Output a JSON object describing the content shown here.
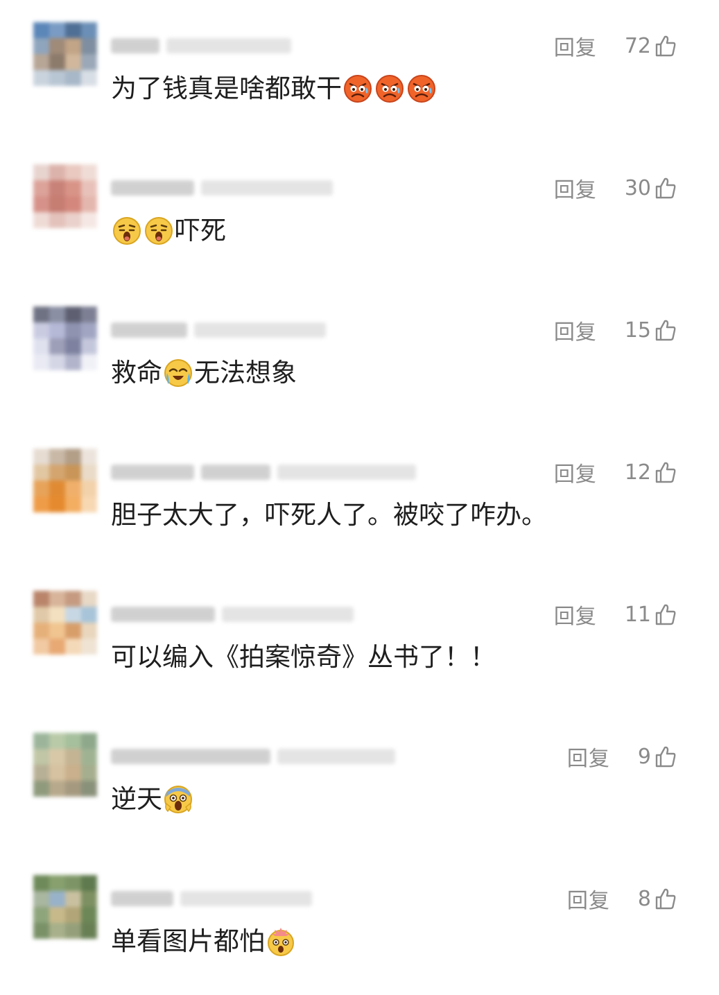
{
  "comments": [
    {
      "reply_label": "回复",
      "like_count": "72",
      "parts": [
        {
          "t": "text",
          "v": "为了钱真是啥都敢干"
        },
        {
          "t": "emoji",
          "icon": "angry-sweat-emoji"
        },
        {
          "t": "emoji",
          "icon": "angry-sweat-emoji"
        },
        {
          "t": "emoji",
          "icon": "angry-sweat-emoji"
        }
      ],
      "avatar_colors": [
        "#5b86b8",
        "#7a9cc4",
        "#4f6f95",
        "#6b8fb6",
        "#8fa5bd",
        "#a08a78",
        "#c2a486",
        "#7f8ea0",
        "#b7a596",
        "#8c7a6a",
        "#d1b79b",
        "#9aa8b8",
        "#c9d3dd",
        "#b8c6d4",
        "#a8b8c8",
        "#d8dee5"
      ],
      "name_blocks": [
        70,
        0,
        180
      ]
    },
    {
      "reply_label": "回复",
      "like_count": "30",
      "parts": [
        {
          "t": "emoji",
          "icon": "shocked-yawn-emoji"
        },
        {
          "t": "emoji",
          "icon": "shocked-yawn-emoji"
        },
        {
          "t": "text",
          "v": "吓死"
        }
      ],
      "avatar_colors": [
        "#e8d4cf",
        "#dcb3ab",
        "#e9c9c0",
        "#f0dcd6",
        "#dca39a",
        "#c98278",
        "#d99488",
        "#e8c2ba",
        "#d6928a",
        "#c67d72",
        "#d4887d",
        "#e4b7ae",
        "#efdbd6",
        "#e3c2bb",
        "#ead1cb",
        "#f5e8e4"
      ],
      "name_blocks": [
        120,
        0,
        190
      ]
    },
    {
      "reply_label": "回复",
      "like_count": "15",
      "parts": [
        {
          "t": "text",
          "v": "救命"
        },
        {
          "t": "emoji",
          "icon": "crying-emoji"
        },
        {
          "t": "text",
          "v": "无法想象"
        }
      ],
      "avatar_colors": [
        "#6f7283",
        "#8b8fa3",
        "#5e6072",
        "#7d8094",
        "#c9cbe1",
        "#b5b9d6",
        "#8f93b0",
        "#a1a5c2",
        "#dfe1ef",
        "#9d9fb8",
        "#7e82a0",
        "#c4c7dc",
        "#e9eaf3",
        "#d4d6e6",
        "#b1b4cb",
        "#f0f1f7"
      ],
      "name_blocks": [
        110,
        0,
        190
      ]
    },
    {
      "reply_label": "回复",
      "like_count": "12",
      "parts": [
        {
          "t": "text",
          "v": "胆子太大了，吓死人了。被咬了咋办。"
        }
      ],
      "avatar_colors": [
        "#e6dcd2",
        "#c9b8a6",
        "#b39e88",
        "#ece4dc",
        "#e2c7a3",
        "#d4a56f",
        "#c99558",
        "#eadbc8",
        "#e7a35a",
        "#e08b34",
        "#f0b06b",
        "#f2d2aa",
        "#ef9c48",
        "#e58a2f",
        "#f3ae62",
        "#f7d8b3"
      ],
      "name_blocks": [
        120,
        100,
        200
      ]
    },
    {
      "reply_label": "回复",
      "like_count": "11",
      "parts": [
        {
          "t": "text",
          "v": "可以编入《拍案惊奇》丛书了！！"
        }
      ],
      "avatar_colors": [
        "#b9846a",
        "#d7b49a",
        "#c59a80",
        "#e8d8c6",
        "#e0c9a8",
        "#f2e0c0",
        "#c7d8e4",
        "#a8c4d8",
        "#e6b07a",
        "#f0c590",
        "#d89e6a",
        "#e9d6bd",
        "#f1c9a2",
        "#e8a974",
        "#f4d9b9",
        "#efe3d3"
      ],
      "name_blocks": [
        150,
        0,
        190
      ]
    },
    {
      "reply_label": "回复",
      "like_count": "9",
      "parts": [
        {
          "t": "text",
          "v": "逆天"
        },
        {
          "t": "emoji",
          "icon": "screaming-emoji"
        }
      ],
      "avatar_colors": [
        "#9cb59a",
        "#b8caa8",
        "#a6bf9c",
        "#8ea88b",
        "#c0c6a6",
        "#d8c8a8",
        "#c4b494",
        "#9fb393",
        "#b8b096",
        "#d6c2a0",
        "#cab08c",
        "#a5ae8e",
        "#8f9a7c",
        "#b7a98b",
        "#a59a80",
        "#8a917a"
      ],
      "name_blocks": [
        230,
        0,
        170
      ]
    },
    {
      "reply_label": "回复",
      "like_count": "8",
      "parts": [
        {
          "t": "text",
          "v": "单看图片都怕"
        },
        {
          "t": "emoji",
          "icon": "exploding-head-emoji"
        }
      ],
      "avatar_colors": [
        "#6f8a5a",
        "#87a06e",
        "#7d9566",
        "#5f7a4e",
        "#a9b6a0",
        "#98b2c9",
        "#c9c0a0",
        "#7d9062",
        "#8ea57c",
        "#c8b98a",
        "#b2a678",
        "#6d8757",
        "#7a9168",
        "#a7b08a",
        "#95a07a",
        "#687f54"
      ],
      "name_blocks": [
        90,
        0,
        190
      ]
    }
  ],
  "colors": {
    "meta_text": "#8a8a8a",
    "comment_text": "#1e1e1e"
  }
}
